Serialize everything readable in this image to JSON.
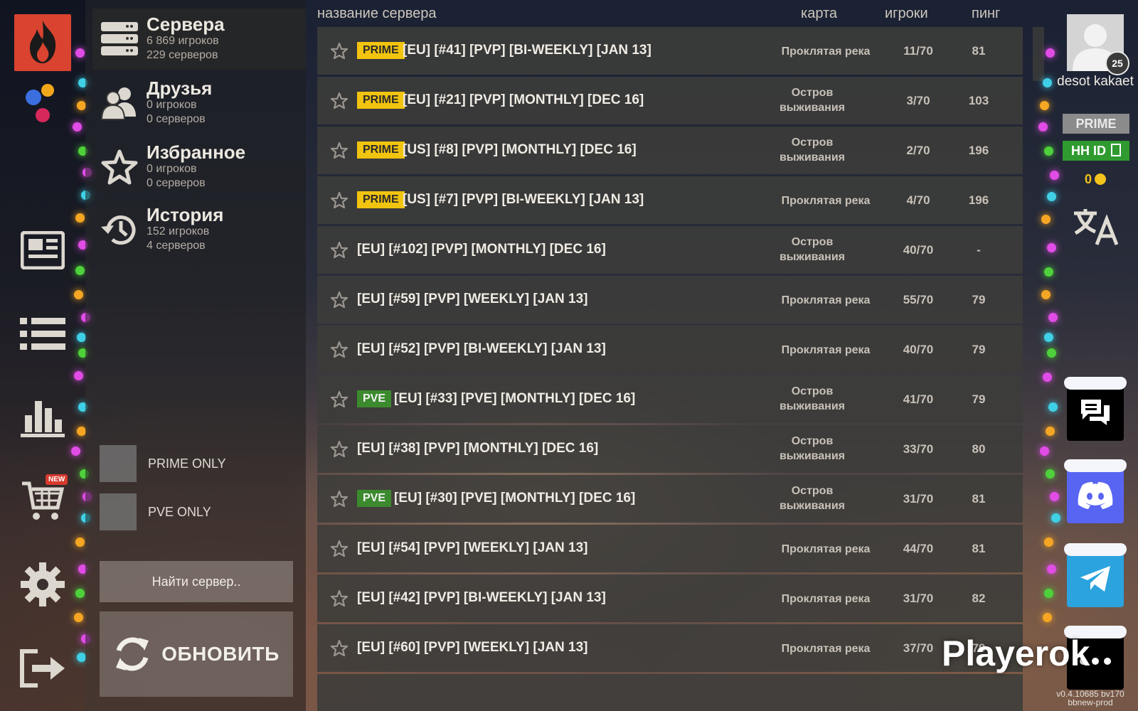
{
  "sidebar_nav": {
    "items": [
      {
        "name": "news",
        "icon": "newspaper-icon"
      },
      {
        "name": "server-list",
        "icon": "list-icon"
      },
      {
        "name": "stats",
        "icon": "bar-chart-icon"
      },
      {
        "name": "shop",
        "icon": "cart-icon",
        "badge": "NEW"
      },
      {
        "name": "settings",
        "icon": "gear-icon"
      },
      {
        "name": "exit",
        "icon": "exit-icon"
      }
    ]
  },
  "categories": [
    {
      "title": "Сервера",
      "players": "6 869 игроков",
      "servers": "229 серверов",
      "icon": "servers-icon",
      "active": true
    },
    {
      "title": "Друзья",
      "players": "0 игроков",
      "servers": "0 серверов",
      "icon": "friends-icon"
    },
    {
      "title": "Избранное",
      "players": "0 игроков",
      "servers": "0 серверов",
      "icon": "star-icon"
    },
    {
      "title": "История",
      "players": "152 игроков",
      "servers": "4 серверов",
      "icon": "history-icon"
    }
  ],
  "filters": {
    "prime_only": "PRIME ONLY",
    "pve_only": "PVE ONLY"
  },
  "search": {
    "placeholder": "Найти сервер.."
  },
  "refresh": {
    "label": "ОБНОВИТЬ"
  },
  "table": {
    "headers": {
      "name": "название сервера",
      "map": "карта",
      "players": "игроки",
      "ping": "пинг"
    },
    "rows": [
      {
        "badge": "PRIME",
        "name": "[EU] [#41] [PVP] [BI-WEEKLY] [JAN 13]",
        "map": "Проклятая река",
        "players": "11/70",
        "ping": "81"
      },
      {
        "badge": "PRIME",
        "name": "[EU] [#21] [PVP] [MONTHLY] [DEC 16]",
        "map": "Остров выживания",
        "players": "3/70",
        "ping": "103"
      },
      {
        "badge": "PRIME",
        "name": "[US] [#8] [PVP] [MONTHLY] [DEC 16]",
        "map": "Остров выживания",
        "players": "2/70",
        "ping": "196"
      },
      {
        "badge": "PRIME",
        "name": "[US] [#7] [PVP] [BI-WEEKLY] [JAN 13]",
        "map": "Проклятая река",
        "players": "4/70",
        "ping": "196"
      },
      {
        "badge": "",
        "name": "[EU] [#102] [PVP] [MONTHLY] [DEC 16]",
        "map": "Остров выживания",
        "players": "40/70",
        "ping": "-"
      },
      {
        "badge": "",
        "name": "[EU] [#59] [PVP] [WEEKLY] [JAN 13]",
        "map": "Проклятая река",
        "players": "55/70",
        "ping": "79"
      },
      {
        "badge": "",
        "name": "[EU] [#52] [PVP] [BI-WEEKLY] [JAN 13]",
        "map": "Проклятая река",
        "players": "40/70",
        "ping": "79"
      },
      {
        "badge": "PVE",
        "name": "[EU] [#33] [PVE] [MONTHLY] [DEC 16]",
        "map": "Остров выживания",
        "players": "41/70",
        "ping": "79"
      },
      {
        "badge": "",
        "name": "[EU] [#38] [PVP] [MONTHLY] [DEC 16]",
        "map": "Остров выживания",
        "players": "33/70",
        "ping": "80"
      },
      {
        "badge": "PVE",
        "name": "[EU] [#30] [PVE] [MONTHLY] [DEC 16]",
        "map": "Остров выживания",
        "players": "31/70",
        "ping": "81"
      },
      {
        "badge": "",
        "name": "[EU] [#54] [PVP] [WEEKLY] [JAN 13]",
        "map": "Проклятая река",
        "players": "44/70",
        "ping": "81"
      },
      {
        "badge": "",
        "name": "[EU] [#42] [PVP] [BI-WEEKLY] [JAN 13]",
        "map": "Проклятая река",
        "players": "31/70",
        "ping": "82"
      },
      {
        "badge": "",
        "name": "[EU] [#60] [PVP] [WEEKLY] [JAN 13]",
        "map": "Проклятая река",
        "players": "37/70",
        "ping": "79"
      }
    ]
  },
  "profile": {
    "username": "desot kakaet",
    "level": "25",
    "prime_label": "PRIME",
    "hh_id_label": "HH ID",
    "coins": "0"
  },
  "social": [
    {
      "name": "chat",
      "icon": "chat-icon",
      "color": "#000000"
    },
    {
      "name": "discord",
      "icon": "discord-icon",
      "color": "#5865F2"
    },
    {
      "name": "telegram",
      "icon": "telegram-icon",
      "color": "#2AA3DF"
    },
    {
      "name": "more",
      "icon": "more-icon",
      "color": "#000000"
    }
  ],
  "watermark": "Playerok",
  "version": {
    "line1": "v0.4.10685 bv170",
    "line2": "bbnew-prod"
  },
  "colors": {
    "prime_badge": "#f1c40f",
    "pve_badge": "#3c8a2e",
    "hh_id": "#2f9a2f",
    "logo": "#d9432f"
  }
}
